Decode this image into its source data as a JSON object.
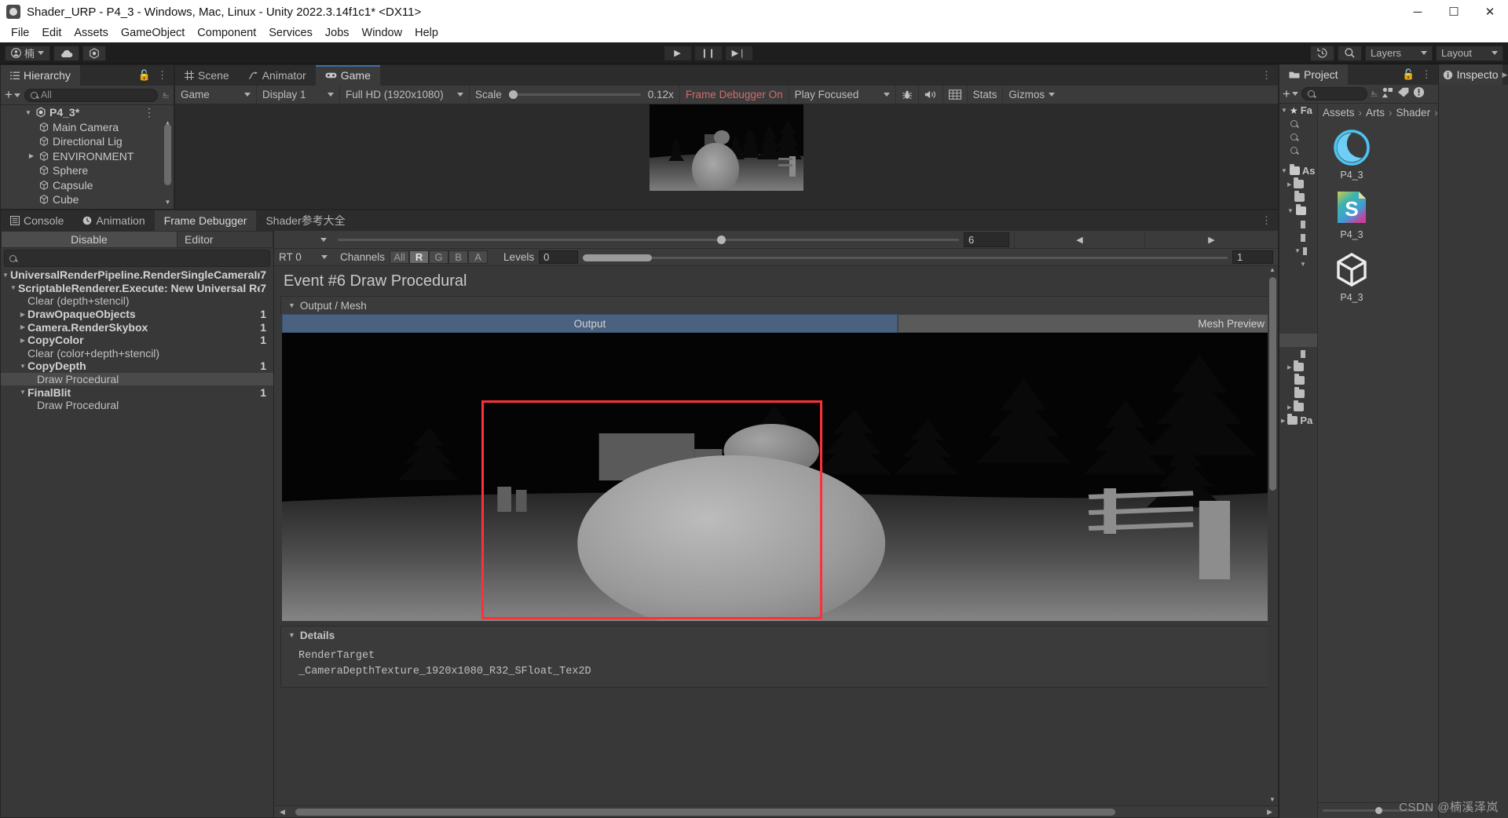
{
  "window": {
    "title": "Shader_URP - P4_3 - Windows, Mac, Linux - Unity 2022.3.14f1c1* <DX11>",
    "minimize": "─",
    "maximize": "☐",
    "close": "✕"
  },
  "menubar": {
    "items": [
      "File",
      "Edit",
      "Assets",
      "GameObject",
      "Component",
      "Services",
      "Jobs",
      "Window",
      "Help"
    ]
  },
  "toolbar": {
    "account_label": "楠",
    "cloud_icon": "cloud-icon",
    "settings_icon": "unity-services-icon",
    "play": "▶",
    "pause": "❙❙",
    "step": "▶❘",
    "history_icon": "undo-history-icon",
    "search_icon": "search-icon",
    "layers_label": "Layers",
    "layout_label": "Layout"
  },
  "hierarchy": {
    "tab": "Hierarchy",
    "create_label": "+",
    "search_placeholder": "All",
    "root": "P4_3*",
    "items": [
      {
        "label": "Main Camera",
        "expandable": false,
        "indent": 2
      },
      {
        "label": "Directional Lig",
        "expandable": false,
        "indent": 2
      },
      {
        "label": "ENVIRONMENT",
        "expandable": true,
        "indent": 2
      },
      {
        "label": "Sphere",
        "expandable": false,
        "indent": 2
      },
      {
        "label": "Capsule",
        "expandable": false,
        "indent": 2
      },
      {
        "label": "Cube",
        "expandable": false,
        "indent": 2
      }
    ]
  },
  "sceneview": {
    "tabs": [
      {
        "label": "Scene",
        "icon": "grid-icon",
        "active": false
      },
      {
        "label": "Animator",
        "icon": "animator-icon",
        "active": false
      },
      {
        "label": "Game",
        "icon": "gamepad-icon",
        "active": true
      }
    ],
    "controls": {
      "mode": "Game",
      "display": "Display 1",
      "resolution": "Full HD (1920x1080)",
      "scale_label": "Scale",
      "scale_value": "0.12x",
      "frame_debugger_status": "Frame Debugger On",
      "play_mode": "Play Focused",
      "mute_icon": "mute-audio-icon",
      "bug_icon": "bug-icon",
      "stats_label": "Stats",
      "gizmos_label": "Gizmos"
    }
  },
  "bottom_tabs": [
    {
      "label": "Console",
      "icon": "console-icon",
      "active": false
    },
    {
      "label": "Animation",
      "icon": "clock-icon",
      "active": false
    },
    {
      "label": "Frame Debugger",
      "icon": "",
      "active": true
    },
    {
      "label": "Shader参考大全",
      "icon": "",
      "active": false
    }
  ],
  "framedebugger": {
    "disable_button": "Disable",
    "editor_dropdown": "Editor",
    "search_placeholder": "",
    "event_slider_value": "6",
    "prev_arrow": "◀",
    "next_arrow": "▶",
    "rt_label": "RT 0",
    "channels_label": "Channels",
    "channels": [
      {
        "label": "All",
        "active": false
      },
      {
        "label": "R",
        "active": true
      },
      {
        "label": "G",
        "active": false
      },
      {
        "label": "B",
        "active": false
      },
      {
        "label": "A",
        "active": false
      }
    ],
    "levels_label": "Levels",
    "levels_min": "0",
    "levels_max": "1",
    "tree": [
      {
        "label": "UniversalRenderPipeline.RenderSingleCameraIntern",
        "count": "7",
        "indent": 0,
        "tri": "down",
        "bold": true,
        "selected": false
      },
      {
        "label": "ScriptableRenderer.Execute: New Universal Rend",
        "count": "7",
        "indent": 1,
        "tri": "down",
        "bold": true,
        "selected": false
      },
      {
        "label": "Clear (depth+stencil)",
        "count": "",
        "indent": 2,
        "tri": "none",
        "bold": false,
        "selected": false
      },
      {
        "label": "DrawOpaqueObjects",
        "count": "1",
        "indent": 2,
        "tri": "right",
        "bold": true,
        "selected": false
      },
      {
        "label": "Camera.RenderSkybox",
        "count": "1",
        "indent": 2,
        "tri": "right",
        "bold": true,
        "selected": false
      },
      {
        "label": "CopyColor",
        "count": "1",
        "indent": 2,
        "tri": "right",
        "bold": true,
        "selected": false
      },
      {
        "label": "Clear (color+depth+stencil)",
        "count": "",
        "indent": 2,
        "tri": "none",
        "bold": false,
        "selected": false
      },
      {
        "label": "CopyDepth",
        "count": "1",
        "indent": 2,
        "tri": "down",
        "bold": true,
        "selected": false
      },
      {
        "label": "Draw Procedural",
        "count": "",
        "indent": 3,
        "tri": "none",
        "bold": false,
        "selected": true
      },
      {
        "label": "FinalBlit",
        "count": "1",
        "indent": 2,
        "tri": "down",
        "bold": true,
        "selected": false
      },
      {
        "label": "Draw Procedural",
        "count": "",
        "indent": 3,
        "tri": "none",
        "bold": false,
        "selected": false
      }
    ],
    "event_title": "Event #6 Draw Procedural",
    "output_section_label": "Output / Mesh",
    "output_tab": "Output",
    "mesh_tab": "Mesh Preview",
    "details_label": "Details",
    "details_lines": [
      "RenderTarget",
      "_CameraDepthTexture_1920x1080_R32_SFloat_Tex2D"
    ]
  },
  "project": {
    "tab": "Project",
    "create_label": "+",
    "search_placeholder": "",
    "tree_items": [
      {
        "label": "Fa",
        "icon": "star-icon",
        "tri": "down",
        "indent": 0
      },
      {
        "label": "",
        "icon": "search-icon",
        "tri": "none",
        "indent": 1
      },
      {
        "label": "",
        "icon": "search-icon",
        "tri": "none",
        "indent": 1
      },
      {
        "label": "",
        "icon": "search-icon",
        "tri": "none",
        "indent": 1
      },
      {
        "label": "As",
        "icon": "folder-open-icon",
        "tri": "down",
        "indent": 0
      },
      {
        "label": "",
        "icon": "folder-icon",
        "tri": "right",
        "indent": 1
      },
      {
        "label": "",
        "icon": "folder-icon",
        "tri": "none",
        "indent": 1
      },
      {
        "label": "",
        "icon": "folder-open-icon",
        "tri": "down",
        "indent": 1
      },
      {
        "label": "",
        "icon": "file-icon",
        "tri": "none",
        "indent": 2
      },
      {
        "label": "",
        "icon": "file-icon",
        "tri": "none",
        "indent": 2
      },
      {
        "label": "",
        "icon": "folder-icon",
        "tri": "down",
        "indent": 2
      },
      {
        "label": "",
        "icon": "",
        "tri": "down",
        "indent": 3
      },
      {
        "label": "",
        "icon": "",
        "tri": "none",
        "indent": 3
      },
      {
        "label": "",
        "icon": "file-icon",
        "tri": "none",
        "indent": 2
      },
      {
        "label": "",
        "icon": "folder-icon",
        "tri": "right",
        "indent": 1
      },
      {
        "label": "",
        "icon": "folder-icon",
        "tri": "none",
        "indent": 1
      },
      {
        "label": "",
        "icon": "folder-icon",
        "tri": "none",
        "indent": 1
      },
      {
        "label": "",
        "icon": "folder-icon",
        "tri": "right",
        "indent": 1
      },
      {
        "label": "Pa",
        "icon": "folder-icon",
        "tri": "right",
        "indent": 0
      }
    ],
    "breadcrumb": [
      "Assets",
      "Arts",
      "Shader"
    ],
    "assets": [
      {
        "label": "P4_3",
        "icon": "material-sphere-icon"
      },
      {
        "label": "P4_3",
        "icon": "shader-s-icon"
      },
      {
        "label": "P4_3",
        "icon": "unity-cube-icon"
      }
    ]
  },
  "inspector": {
    "tab": "Inspecto"
  },
  "watermark": "CSDN @楠溪泽岚",
  "colors": {
    "accent_blue": "#3a6ea5",
    "selection_red": "#ff2f3a",
    "warn_red": "#d36b6b",
    "panel_bg": "#383838",
    "list_bg": "#3b3b3b"
  }
}
